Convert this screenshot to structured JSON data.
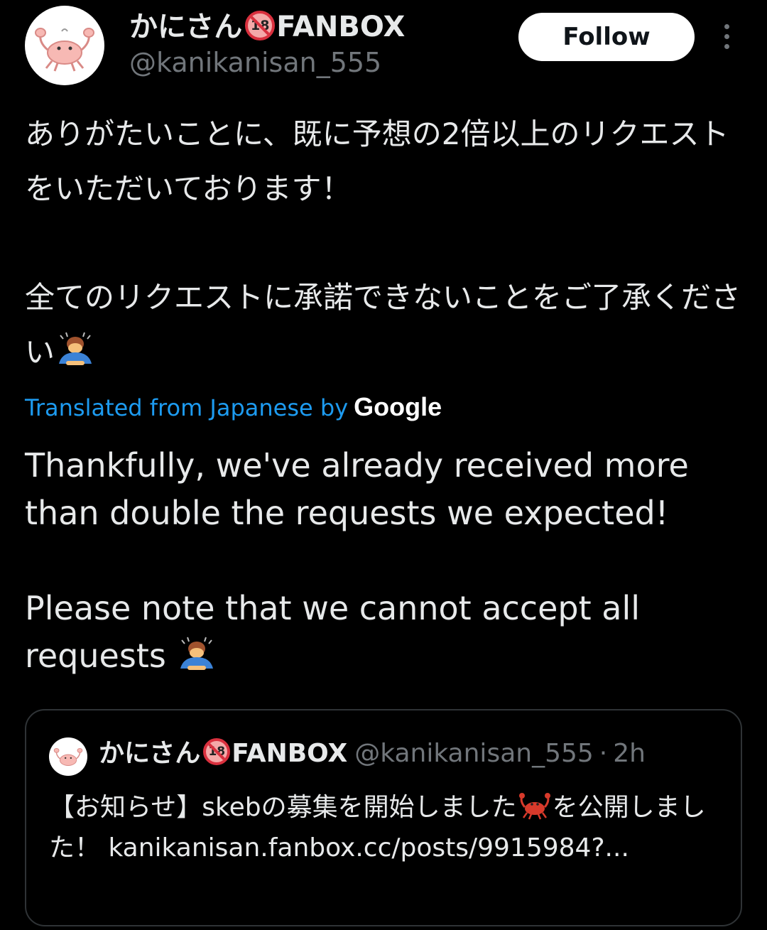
{
  "author": {
    "display_name": "かにさん",
    "badge_text": "18",
    "display_suffix": "FANBOX",
    "handle": "@kanikanisan_555"
  },
  "actions": {
    "follow_label": "Follow"
  },
  "tweet": {
    "jp_line1": "ありがたいことに、既に予想の2倍以上のリクエストをいただいております！",
    "jp_line2": "全てのリクエストに承諾できないことをご了承ください",
    "translated_label": "Translated from Japanese by",
    "translator": "Google",
    "en_line1": "Thankfully, we've already received more than double the requests we expected!",
    "en_line2": "Please note that we cannot accept all requests"
  },
  "quote": {
    "display_name": "かにさん",
    "badge_text": "18",
    "display_suffix": "FANBOX",
    "handle": "@kanikanisan_555",
    "separator": "·",
    "time": "2h",
    "body_part1": "【お知らせ】skebの募集を開始しました",
    "body_part2": "を公開しました！ kanikanisan.fanbox.cc/posts/9915984?..."
  },
  "icons": {
    "avatar": "crab-avatar-icon",
    "more": "more-vertical-icon",
    "bow": "person-bowing-emoji",
    "crab": "crab-emoji",
    "no_under_18": "no-under-18-icon"
  },
  "colors": {
    "background": "#000000",
    "text": "#e7e9ea",
    "muted": "#71767b",
    "link": "#1d9bf0",
    "border": "#2f3336"
  }
}
